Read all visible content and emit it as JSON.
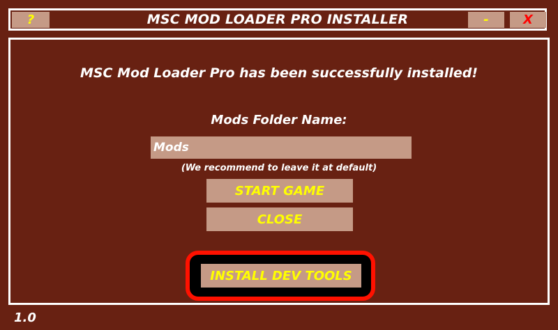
{
  "window": {
    "title": "MSC MOD LOADER PRO INSTALLER",
    "help_label": "?",
    "minimize_label": "-",
    "close_label": "X"
  },
  "main": {
    "success_message": "MSC Mod Loader Pro has been successfully installed!",
    "folder_label": "Mods Folder Name:",
    "folder_value": "Mods",
    "hint": "(We recommend to leave it at default)",
    "start_game_label": "START GAME",
    "close_label": "CLOSE",
    "install_dev_tools_label": "INSTALL DEV TOOLS"
  },
  "footer": {
    "version": "1.0"
  },
  "colors": {
    "background": "#682112",
    "button": "#c59a86",
    "button_text": "#ffff00",
    "close_x": "#ff0000",
    "highlight": "#ff1100"
  }
}
